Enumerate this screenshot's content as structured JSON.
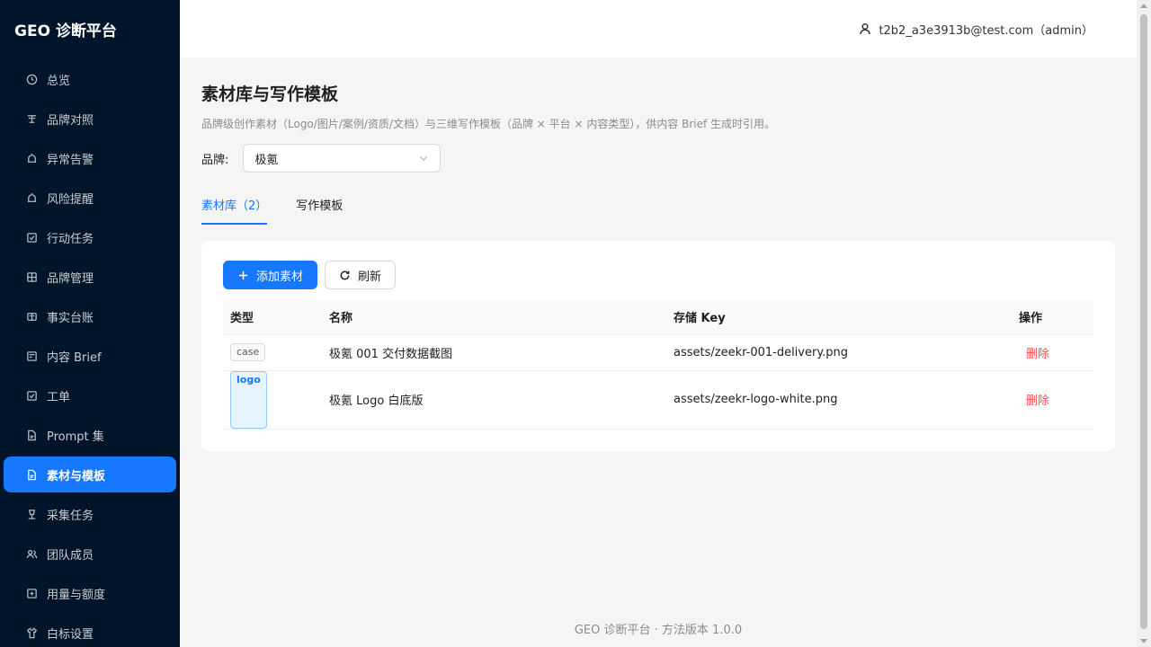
{
  "app": {
    "title": "GEO 诊断平台"
  },
  "sidebar": {
    "items": [
      {
        "label": "总览",
        "icon": "clock-icon"
      },
      {
        "label": "品牌对照",
        "icon": "compare-icon"
      },
      {
        "label": "异常告警",
        "icon": "alert-icon"
      },
      {
        "label": "风险提醒",
        "icon": "risk-icon"
      },
      {
        "label": "行动任务",
        "icon": "check-square-icon"
      },
      {
        "label": "品牌管理",
        "icon": "grid-icon"
      },
      {
        "label": "事实台账",
        "icon": "ledger-icon"
      },
      {
        "label": "内容 Brief",
        "icon": "brief-icon"
      },
      {
        "label": "工单",
        "icon": "ticket-icon"
      },
      {
        "label": "Prompt 集",
        "icon": "file-icon"
      },
      {
        "label": "素材与模板",
        "icon": "file-icon",
        "active": true
      },
      {
        "label": "采集任务",
        "icon": "collect-icon"
      },
      {
        "label": "团队成员",
        "icon": "team-icon"
      },
      {
        "label": "用量与额度",
        "icon": "usage-icon"
      },
      {
        "label": "白标设置",
        "icon": "shirt-icon"
      }
    ]
  },
  "header": {
    "user": "t2b2_a3e3913b@test.com（admin）"
  },
  "main": {
    "title": "素材库与写作模板",
    "description": "品牌级创作素材（Logo/图片/案例/资质/文档）与三维写作模板（品牌 × 平台 × 内容类型），供内容 Brief 生成时引用。",
    "brand_label": "品牌:",
    "brand_value": "极氪",
    "tabs": [
      {
        "label": "素材库（2）",
        "active": true
      },
      {
        "label": "写作模板"
      }
    ],
    "toolbar": {
      "add_label": "添加素材",
      "refresh_label": "刷新"
    },
    "table": {
      "columns": [
        "类型",
        "名称",
        "存储 Key",
        "操作"
      ],
      "rows": [
        {
          "type": "case",
          "name": "极氪 001 交付数据截图",
          "key": "assets/zeekr-001-delivery.png",
          "action": "删除"
        },
        {
          "type": "logo",
          "name": "极氪 Logo 白底版",
          "key": "assets/zeekr-logo-white.png",
          "action": "删除"
        }
      ]
    }
  },
  "footer": {
    "text": "GEO 诊断平台 · 方法版本 1.0.0"
  },
  "colors": {
    "primary": "#1677ff",
    "sidebar_bg": "#001529",
    "danger": "#ff4d4f"
  }
}
